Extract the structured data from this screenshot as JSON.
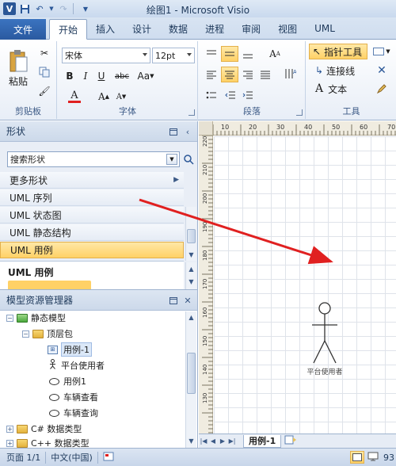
{
  "window": {
    "title": "绘图1 - Microsoft Visio",
    "app_icon": "V"
  },
  "tabs": [
    "文件",
    "开始",
    "插入",
    "设计",
    "数据",
    "进程",
    "审阅",
    "视图",
    "UML"
  ],
  "ribbon": {
    "clipboard": {
      "label": "剪贴板",
      "paste": "粘贴"
    },
    "font": {
      "label": "字体",
      "family": "宋体",
      "size": "12pt",
      "bold": "B",
      "italic": "I",
      "underline": "U",
      "strike": "abc",
      "case": "Aa",
      "grow": "A",
      "shrink": "A",
      "color_letter": "A"
    },
    "paragraph": {
      "label": "段落"
    },
    "tools": {
      "label": "工具",
      "pointer": "指针工具",
      "connector": "连接线",
      "text": "文本",
      "text_glyph": "A"
    }
  },
  "shapes_pane": {
    "title": "形状",
    "search_placeholder": "搜索形状",
    "items": [
      "更多形状",
      "UML 序列",
      "UML 状态图",
      "UML 静态结构",
      "UML 用例"
    ],
    "selected_stencil": "UML 用例"
  },
  "model_explorer": {
    "title": "模型资源管理器",
    "tree": [
      {
        "label": "静态模型",
        "level": 0,
        "icon": "folder-green"
      },
      {
        "label": "顶层包",
        "level": 1,
        "icon": "folder"
      },
      {
        "label": "用例-1",
        "level": 2,
        "icon": "diagram"
      },
      {
        "label": "平台使用者",
        "level": 2,
        "icon": "actor"
      },
      {
        "label": "用例1",
        "level": 2,
        "icon": "ellipse"
      },
      {
        "label": "车辆查看",
        "level": 2,
        "icon": "ellipse"
      },
      {
        "label": "车辆查询",
        "level": 2,
        "icon": "ellipse"
      },
      {
        "label": "C# 数据类型",
        "level": 0,
        "icon": "folder"
      },
      {
        "label": "C++ 数据类型",
        "level": 0,
        "icon": "folder"
      }
    ]
  },
  "canvas": {
    "hruler_labels": [
      "10",
      "20",
      "30",
      "40",
      "50",
      "60",
      "70"
    ],
    "vruler_labels": [
      "220",
      "210",
      "200",
      "190",
      "180",
      "170",
      "160",
      "150",
      "140",
      "130"
    ],
    "actor_label": "平台使用者",
    "page_tab": "用例-1"
  },
  "status": {
    "page": "页面 1/1",
    "language": "中文(中国)",
    "zoom": "93"
  },
  "colors": {
    "accent": "#2b5797",
    "selection": "#ffd166",
    "arrow": "#e02020"
  }
}
